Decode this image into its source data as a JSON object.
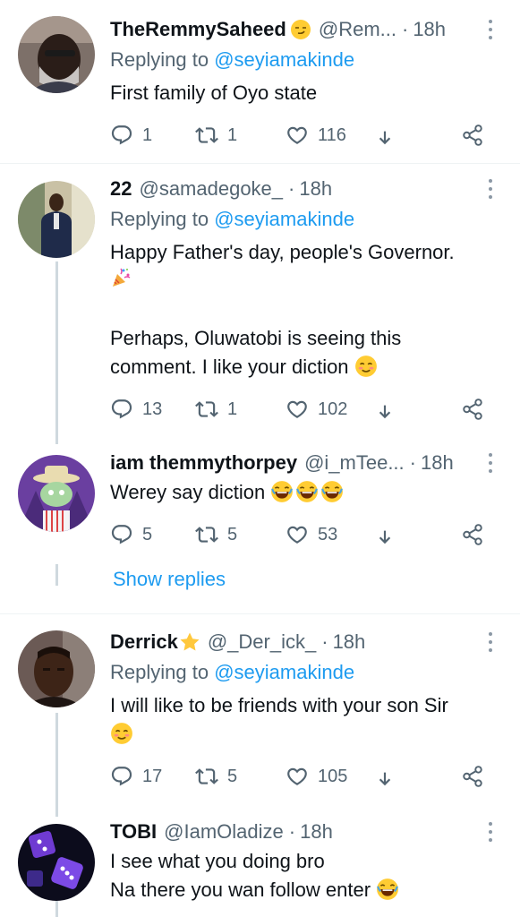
{
  "tweets": [
    {
      "name": "TheRemmySaheed",
      "name_emoji": "smirk-emoji",
      "handle": "@Rem...",
      "time": "18h",
      "replying_label": "Replying to",
      "replying_to": "@seyiamakinde",
      "text": "First family of Oyo state",
      "replies": "1",
      "retweets": "1",
      "likes": "116"
    },
    {
      "name": "22",
      "handle": "@samadegoke_",
      "time": "18h",
      "replying_label": "Replying to",
      "replying_to": "@seyiamakinde",
      "text_line1": "Happy Father's day, people's Governor.",
      "text_line2": "Perhaps, Oluwatobi is seeing this",
      "text_line3": "comment. I like your diction",
      "replies": "13",
      "retweets": "1",
      "likes": "102"
    },
    {
      "name": "iam themmythorpey",
      "handle": "@i_mTee...",
      "time": "18h",
      "text": "Werey say diction",
      "replies": "5",
      "retweets": "5",
      "likes": "53"
    },
    {
      "name": "Derrick",
      "name_emoji": "star-emoji",
      "handle": "@_Der_ick_",
      "time": "18h",
      "replying_label": "Replying to",
      "replying_to": "@seyiamakinde",
      "text": "I will like to be friends with your son Sir",
      "replies": "17",
      "retweets": "5",
      "likes": "105"
    },
    {
      "name": "TOBI",
      "handle": "@IamOladize",
      "time": "18h",
      "text_line1": "I see what you doing bro",
      "text_line2": "Na there you wan follow enter"
    }
  ],
  "show_replies": "Show replies",
  "separator": "·",
  "colors": {
    "accent": "#1d9bf0",
    "secondary": "#536471",
    "text": "#0f1419",
    "line": "#cfd9de"
  }
}
